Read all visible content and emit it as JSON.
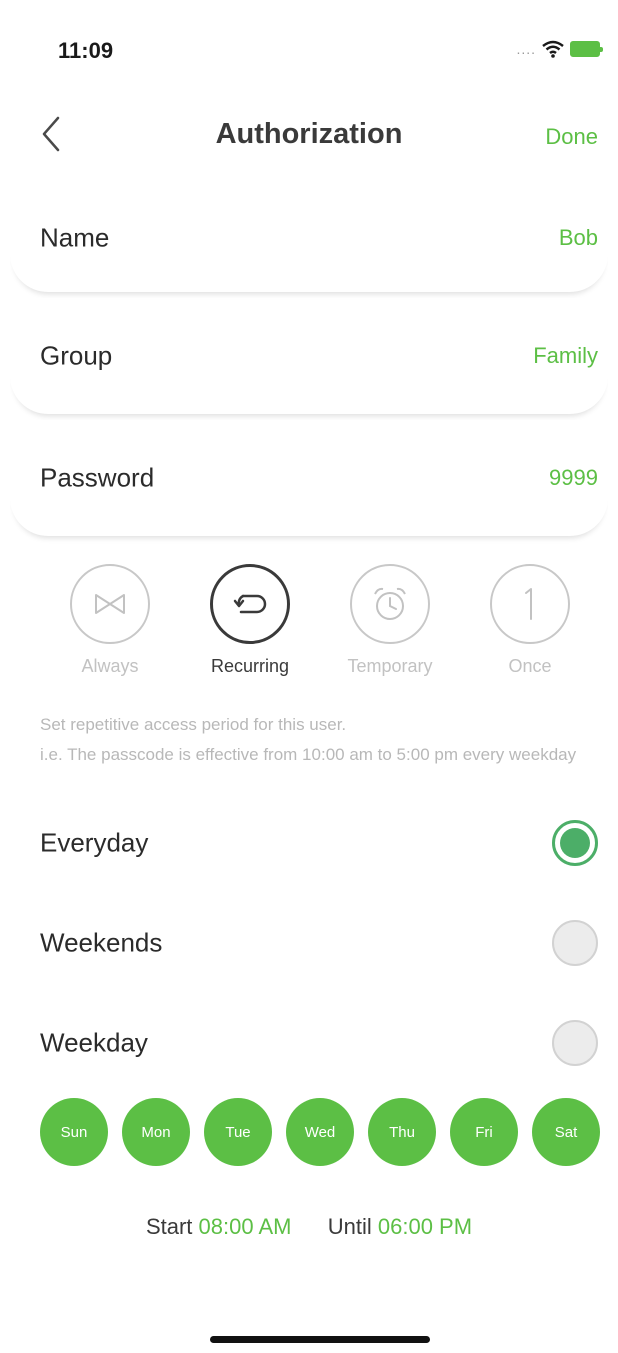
{
  "status_bar": {
    "time": "11:09",
    "signal": "....",
    "icons": [
      "wifi-icon",
      "battery-icon"
    ]
  },
  "nav": {
    "title": "Authorization",
    "done_label": "Done",
    "back_icon": "chevron-left-icon"
  },
  "form": {
    "name": {
      "label": "Name",
      "value": "Bob"
    },
    "group": {
      "label": "Group",
      "value": "Family"
    },
    "password": {
      "label": "Password",
      "value": "9999"
    }
  },
  "modes": [
    {
      "label": "Always",
      "icon": "bowtie-icon",
      "active": false
    },
    {
      "label": "Recurring",
      "icon": "repeat-icon",
      "active": true
    },
    {
      "label": "Temporary",
      "icon": "alarm-clock-icon",
      "active": false
    },
    {
      "label": "Once",
      "icon": "number-one-icon",
      "active": false
    }
  ],
  "description": {
    "line1": "Set repetitive access period for this user.",
    "line2": "i.e. The passcode is effective from 10:00 am to 5:00 pm every weekday"
  },
  "options": [
    {
      "label": "Everyday",
      "checked": true
    },
    {
      "label": "Weekends",
      "checked": false
    },
    {
      "label": "Weekday",
      "checked": false
    }
  ],
  "days": [
    "Sun",
    "Mon",
    "Tue",
    "Wed",
    "Thu",
    "Fri",
    "Sat"
  ],
  "time_range": {
    "start_label": "Start",
    "start_value": "08:00 AM",
    "until_label": "Until",
    "until_value": "06:00 PM"
  },
  "colors": {
    "accent": "#5cbf45",
    "radio_checked": "#4cae68",
    "muted_text": "#b8b8b8"
  }
}
